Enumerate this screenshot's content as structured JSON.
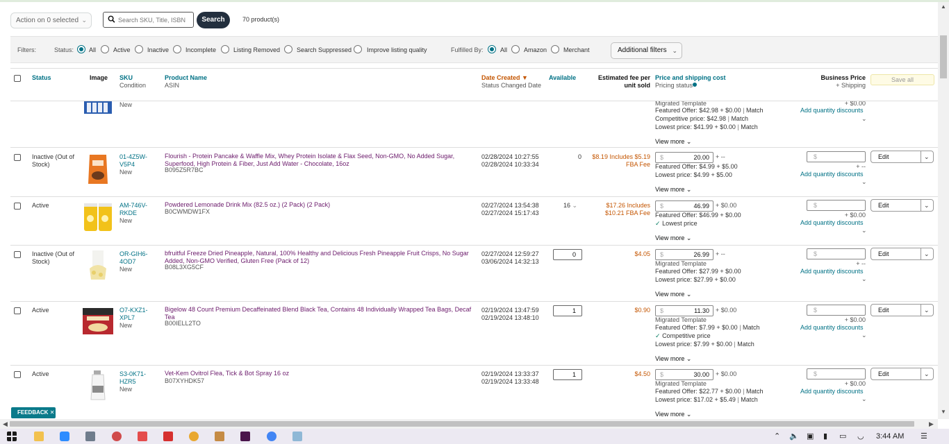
{
  "toolbar": {
    "action_label": "Action on 0 selected",
    "search_placeholder": "Search SKU, Title, ISBN",
    "search_button": "Search",
    "product_count": "70 product(s)"
  },
  "filters": {
    "label": "Filters:",
    "status_label": "Status:",
    "status_options": [
      "All",
      "Active",
      "Inactive",
      "Incomplete",
      "Listing Removed",
      "Search Suppressed",
      "Improve listing quality"
    ],
    "status_selected": "All",
    "fulfilled_label": "Fulfilled By:",
    "fulfilled_options": [
      "All",
      "Amazon",
      "Merchant"
    ],
    "fulfilled_selected": "All",
    "additional_filters": "Additional filters"
  },
  "columns": {
    "status": "Status",
    "image": "Image",
    "sku": "SKU",
    "condition": "Condition",
    "product_name": "Product Name",
    "asin": "ASIN",
    "date_created": "Date Created",
    "status_changed": "Status Changed Date",
    "available": "Available",
    "est_fee_1": "Estimated fee per",
    "est_fee_2": "unit sold",
    "price_shipping": "Price and shipping cost",
    "pricing_status": "Pricing status",
    "business_price": "Business Price",
    "plus_shipping": "+ Shipping",
    "save_all": "Save all"
  },
  "partial_row": {
    "condition": "New",
    "migrated": "Migrated Template",
    "featured": "Featured Offer: $42.98 + $0.00",
    "featured_match": "Match",
    "competitive": "Competitive price: $42.98",
    "competitive_match": "Match",
    "lowest": "Lowest price: $41.99 + $0.00",
    "lowest_match": "Match",
    "view_more": "View more",
    "biz_ship": "+ $0.00",
    "qty_discounts": "Add quantity discounts"
  },
  "rows": [
    {
      "status": "Inactive (Out of Stock)",
      "sku": "01-4Z5W-V5P4",
      "condition": "New",
      "name": "Flourish - Protein Pancake & Waffle Mix, Whey Protein Isolate & Flax Seed, Non-GMO, No Added Sugar, Superfood, High Protein & Fiber, Just Add Water - Chocolate, 16oz",
      "asin": "B095Z5R7BC",
      "date_created": "02/28/2024 10:27:55",
      "status_changed": "02/28/2024 10:33:34",
      "available": "0",
      "fee": "$8.19 Includes $5.19 FBA Fee",
      "price": "20.00",
      "shipping": "+ --",
      "lines": [
        "Featured Offer: $4.99 + $5.00",
        "Lowest price: $4.99 + $5.00"
      ],
      "view_more": "View more",
      "biz_price_placeholder": "$",
      "biz_ship": "+ --",
      "qty_discounts": "Add quantity discounts",
      "edit": "Edit"
    },
    {
      "status": "Active",
      "sku": "AM-746V-RKDE",
      "condition": "New",
      "name": "Powdered Lemonade Drink Mix (82.5 oz.) (2 Pack) (2 Pack)",
      "asin": "B0CWMDW1FX",
      "date_created": "02/27/2024 13:54:38",
      "status_changed": "02/27/2024 15:17:43",
      "available": "16",
      "fee": "$17.26 Includes $10.21 FBA Fee",
      "price": "46.99",
      "shipping": "+ $0.00",
      "lines": [
        "Featured Offer: $46.99 + $0.00"
      ],
      "badge": "Lowest price",
      "view_more": "View more",
      "biz_price_placeholder": "$",
      "biz_ship": "+ $0.00",
      "qty_discounts": "Add quantity discounts",
      "edit": "Edit"
    },
    {
      "status": "Inactive (Out of Stock)",
      "sku": "OR-GIH6-4OD7",
      "condition": "New",
      "name": "bfruitful Freeze Dried Pineapple, Natural, 100% Healthy and Delicious Fresh Pineapple Fruit Crisps, No Sugar Added, Non-GMO Verified, Gluten Free (Pack of 12)",
      "asin": "B08L3XG5CF",
      "date_created": "02/27/2024 12:59:27",
      "status_changed": "03/06/2024 14:32:13",
      "available": "0",
      "fee": "$4.05",
      "price": "26.99",
      "shipping": "+ --",
      "lines": [
        "Migrated Template",
        "Featured Offer: $27.99 + $0.00",
        "Lowest price: $27.99 + $0.00"
      ],
      "view_more": "View more",
      "biz_price_placeholder": "$",
      "biz_ship": "+ --",
      "qty_discounts": "Add quantity discounts",
      "edit": "Edit"
    },
    {
      "status": "Active",
      "sku": "O7-KXZ1-XPL7",
      "condition": "New",
      "name": "Bigelow 48 Count Premium Decaffeinated Blend Black Tea, Contains 48 Individually Wrapped Tea Bags, Decaf Tea",
      "asin": "B00IELL2TO",
      "date_created": "02/19/2024 13:47:59",
      "status_changed": "02/19/2024 13:48:10",
      "available": "1",
      "fee": "$0.90",
      "price": "11.30",
      "shipping": "+ $0.00",
      "migrated": "Migrated Template",
      "featured": "Featured Offer: $7.99 + $0.00",
      "featured_match": "Match",
      "badge": "Competitive price",
      "lowest": "Lowest price: $7.99 + $0.00",
      "lowest_match": "Match",
      "view_more": "View more",
      "biz_price_placeholder": "$",
      "biz_ship": "+ $0.00",
      "qty_discounts": "Add quantity discounts",
      "edit": "Edit"
    },
    {
      "status": "Active",
      "sku": "S3-0K71-HZR5",
      "condition": "New",
      "name": "Vet-Kem Ovitrol Flea, Tick & Bot Spray 16 oz",
      "asin": "B07XYHDK57",
      "date_created": "02/19/2024 13:33:37",
      "status_changed": "02/19/2024 13:33:48",
      "available": "1",
      "fee": "$4.50",
      "price": "30.00",
      "shipping": "+ $0.00",
      "migrated": "Migrated Template",
      "featured": "Featured Offer: $22.77 + $0.00",
      "featured_match": "Match",
      "lowest": "Lowest price: $17.02 + $5.49",
      "lowest_match": "Match",
      "view_more": "View more",
      "biz_price_placeholder": "$",
      "biz_ship": "+ $0.00",
      "qty_discounts": "Add quantity discounts",
      "edit": "Edit"
    }
  ],
  "feedback": "FEEDBACK",
  "taskbar": {
    "clock": "3:44 AM",
    "colors": {
      "accent": "#007185",
      "link": "#007185",
      "product": "#6b1a6b",
      "fee": "#c45500",
      "search_btn": "#232f3e",
      "feedback": "#0a7a8a"
    }
  }
}
